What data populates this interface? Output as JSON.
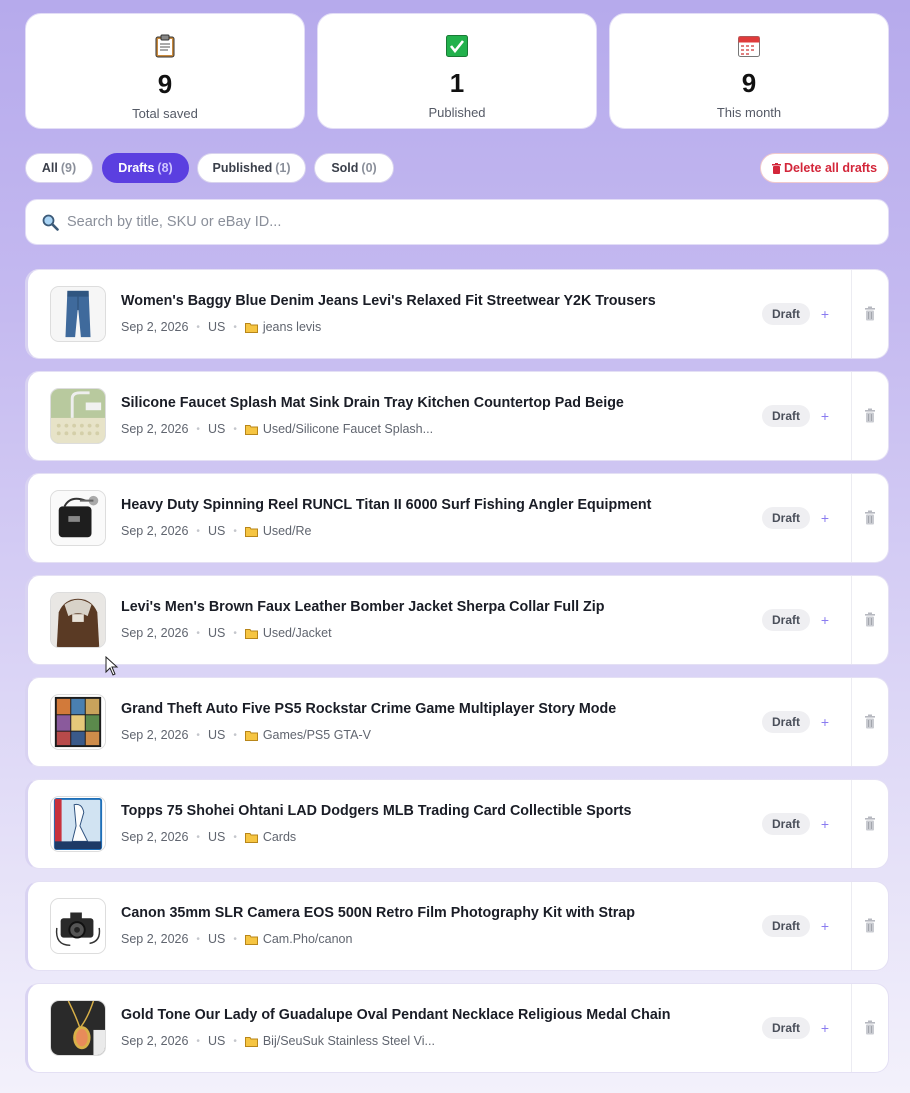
{
  "stats": [
    {
      "value": "9",
      "label": "Total saved",
      "icon": "clipboard-icon"
    },
    {
      "value": "1",
      "label": "Published",
      "icon": "check-icon"
    },
    {
      "value": "9",
      "label": "This month",
      "icon": "calendar-icon"
    }
  ],
  "tabs": [
    {
      "label": "All",
      "count": "(9)"
    },
    {
      "label": "Drafts",
      "count": "(8)"
    },
    {
      "label": "Published",
      "count": "(1)"
    },
    {
      "label": "Sold",
      "count": "(0)"
    }
  ],
  "delete_all_label": "Delete all drafts",
  "search": {
    "placeholder": "Search by title, SKU or eBay ID..."
  },
  "items": [
    {
      "title": "Women's Baggy Blue Denim Jeans Levi's Relaxed Fit Streetwear Y2K Trousers",
      "date": "Sep 2, 2026",
      "region": "US",
      "folder": "jeans levis",
      "status": "Draft"
    },
    {
      "title": "Silicone Faucet Splash Mat Sink Drain Tray Kitchen Countertop Pad Beige",
      "date": "Sep 2, 2026",
      "region": "US",
      "folder": "Used/Silicone Faucet Splash...",
      "status": "Draft"
    },
    {
      "title": "Heavy Duty Spinning Reel RUNCL Titan II 6000 Surf Fishing Angler Equipment",
      "date": "Sep 2, 2026",
      "region": "US",
      "folder": "Used/Re",
      "status": "Draft"
    },
    {
      "title": "Levi's Men's Brown Faux Leather Bomber Jacket Sherpa Collar Full Zip",
      "date": "Sep 2, 2026",
      "region": "US",
      "folder": "Used/Jacket",
      "status": "Draft"
    },
    {
      "title": "Grand Theft Auto Five PS5 Rockstar Crime Game Multiplayer Story Mode",
      "date": "Sep 2, 2026",
      "region": "US",
      "folder": "Games/PS5 GTA-V",
      "status": "Draft"
    },
    {
      "title": "Topps 75 Shohei Ohtani LAD Dodgers MLB Trading Card Collectible Sports",
      "date": "Sep 2, 2026",
      "region": "US",
      "folder": "Cards",
      "status": "Draft"
    },
    {
      "title": "Canon 35mm SLR Camera EOS 500N Retro Film Photography Kit with Strap",
      "date": "Sep 2, 2026",
      "region": "US",
      "folder": "Cam.Pho/canon",
      "status": "Draft"
    },
    {
      "title": "Gold Tone Our Lady of Guadalupe Oval Pendant Necklace Religious Medal Chain",
      "date": "Sep 2, 2026",
      "region": "US",
      "folder": "Bij/SeuSuk Stainless Steel Vi...",
      "status": "Draft"
    }
  ],
  "colors": {
    "accent": "#5b3fe0",
    "danger": "#d3263a",
    "plus": "#8a7cf0"
  }
}
